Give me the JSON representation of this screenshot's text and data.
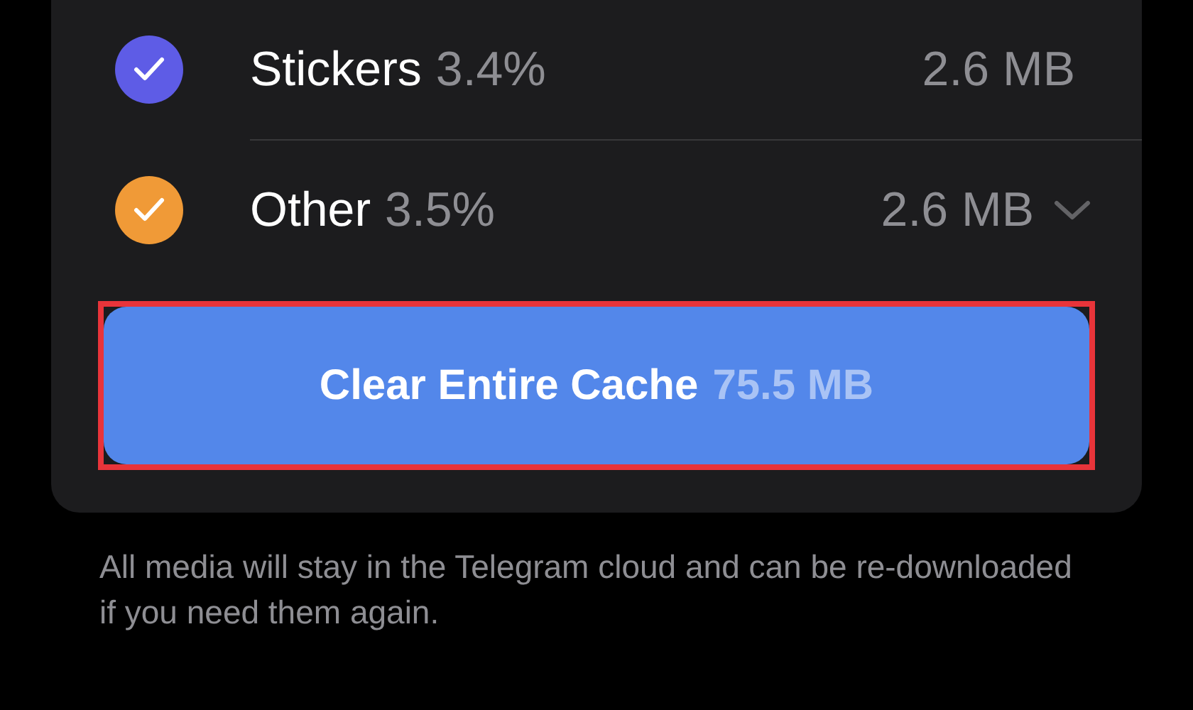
{
  "categories": [
    {
      "name": "Stickers",
      "percent": "3.4%",
      "size": "2.6 MB",
      "checked": true,
      "color": "#5e5ce6",
      "expandable": false
    },
    {
      "name": "Other",
      "percent": "3.5%",
      "size": "2.6 MB",
      "checked": true,
      "color": "#f09a37",
      "expandable": true
    }
  ],
  "clear_button": {
    "label": "Clear Entire Cache",
    "size": "75.5 MB",
    "highlighted": true
  },
  "footer": "All media will stay in the Telegram cloud and can be re-downloaded if you need them again."
}
